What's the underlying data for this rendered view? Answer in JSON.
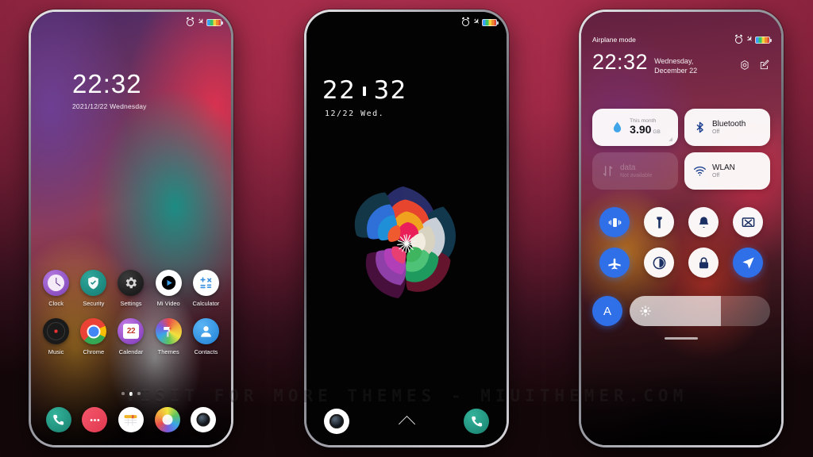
{
  "watermark": "VISIT FOR MORE THEMES - MIUITHEMER.COM",
  "colors": {
    "accent_blue": "#2f6fe8",
    "background_crimson": "#9e2946",
    "card_white": "#f2f2f4",
    "teal": "#17806e"
  },
  "phone1": {
    "status": {
      "left": "",
      "alarm_icon": "alarm-icon",
      "airplane_icon": "airplane-icon",
      "battery_icon": "battery-icon"
    },
    "clock": {
      "time": "22:32",
      "date": "2021/12/22 Wednesday"
    },
    "apps_row1": [
      {
        "label": "Clock",
        "icon": "clock-app-icon"
      },
      {
        "label": "Security",
        "icon": "security-app-icon"
      },
      {
        "label": "Settings",
        "icon": "settings-app-icon"
      },
      {
        "label": "Mi Video",
        "icon": "mi-video-app-icon"
      },
      {
        "label": "Calculator",
        "icon": "calculator-app-icon"
      }
    ],
    "apps_row2": [
      {
        "label": "Music",
        "icon": "music-app-icon"
      },
      {
        "label": "Chrome",
        "icon": "chrome-app-icon"
      },
      {
        "label": "Calendar",
        "icon": "calendar-app-icon",
        "day": "22"
      },
      {
        "label": "Themes",
        "icon": "themes-app-icon"
      },
      {
        "label": "Contacts",
        "icon": "contacts-app-icon"
      }
    ],
    "page_dots": {
      "count": 3,
      "active_index": 1
    },
    "dock": [
      {
        "icon": "phone-dock-icon"
      },
      {
        "icon": "messages-dock-icon"
      },
      {
        "icon": "calendar-dock-icon"
      },
      {
        "icon": "gallery-dock-icon"
      },
      {
        "icon": "camera-dock-icon"
      }
    ]
  },
  "phone2": {
    "clock": {
      "hours": "22",
      "minutes": "32",
      "date": "12/22  Wed."
    },
    "wallpaper": "multicolor-rose-flower",
    "bottom": [
      {
        "icon": "camera-shortcut-icon"
      },
      {
        "icon": "swipe-up-chevron-icon"
      },
      {
        "icon": "phone-shortcut-icon"
      }
    ]
  },
  "phone3": {
    "status": {
      "left": "Airplane mode"
    },
    "header": {
      "time": "22:32",
      "date_line1": "Wednesday,",
      "date_line2": "December 22",
      "settings_icon": "gear-icon",
      "edit_icon": "edit-icon"
    },
    "cards": [
      {
        "name": "data-usage-card",
        "sub": "This month",
        "value": "3.90",
        "unit": "GB",
        "icon": "data-drop-icon",
        "dim": false
      },
      {
        "name": "bluetooth-card",
        "title": "Bluetooth",
        "status": "Off",
        "icon": "bluetooth-icon",
        "dim": false
      },
      {
        "name": "mobile-data-card",
        "title": "data",
        "status": "Not available",
        "icon": "data-arrows-icon",
        "dim": true
      },
      {
        "name": "wlan-card",
        "title": "WLAN",
        "status": "Off",
        "icon": "wifi-icon",
        "dim": false
      }
    ],
    "toggles": [
      {
        "name": "vibrate-toggle",
        "icon": "vibrate-icon",
        "on": true
      },
      {
        "name": "flashlight-toggle",
        "icon": "flashlight-icon",
        "on": false
      },
      {
        "name": "ringer-toggle",
        "icon": "bell-icon",
        "on": false
      },
      {
        "name": "cast-toggle",
        "icon": "cast-icon",
        "on": false
      },
      {
        "name": "airplane-toggle",
        "icon": "airplane-icon",
        "on": true
      },
      {
        "name": "dark-mode-toggle",
        "icon": "contrast-icon",
        "on": false
      },
      {
        "name": "lock-toggle",
        "icon": "lock-icon",
        "on": false
      },
      {
        "name": "location-toggle",
        "icon": "location-arrow-icon",
        "on": true
      }
    ],
    "brightness": {
      "auto_label": "A",
      "level_percent": 65,
      "icon": "brightness-sun-icon"
    }
  }
}
